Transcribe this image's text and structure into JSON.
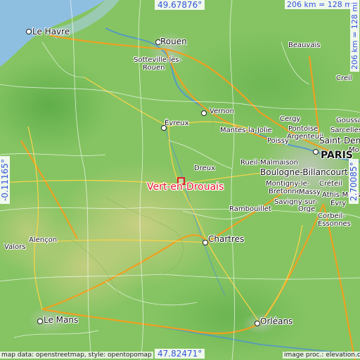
{
  "target": {
    "name": "Vert-en-Drouais",
    "color": "#e8182a"
  },
  "coordinates": {
    "top": "49.67876°",
    "bottom": "47.82471°",
    "left": "-0.11165°",
    "right": "2.70085°"
  },
  "scale": {
    "horizontal": "206 km = 128 mi",
    "vertical": "206 km = 128 mi"
  },
  "credits": {
    "left": "map data: openstreetmap, style: opentopomap",
    "right": "image proc.: elevation.city"
  },
  "places": [
    {
      "key": "le-havre",
      "name": "Le Havre"
    },
    {
      "key": "rouen",
      "name": "Rouen"
    },
    {
      "key": "sotteville",
      "name": "Sotteville-lès-"
    },
    {
      "key": "sotteville-2",
      "name": "Rouen"
    },
    {
      "key": "beauvais",
      "name": "Beauvais"
    },
    {
      "key": "creil",
      "name": "Creil"
    },
    {
      "key": "vernon",
      "name": "Vernon"
    },
    {
      "key": "evreux",
      "name": "Évreux"
    },
    {
      "key": "mantes",
      "name": "Mantes-la-Jolie"
    },
    {
      "key": "cergy",
      "name": "Cergy"
    },
    {
      "key": "pontoise",
      "name": "Pontoise"
    },
    {
      "key": "argenteuil",
      "name": "Argenteuil"
    },
    {
      "key": "poissy",
      "name": "Poissy"
    },
    {
      "key": "saint-denis",
      "name": "Saint-Denis"
    },
    {
      "key": "goussainville",
      "name": "Goussa"
    },
    {
      "key": "sarcelles",
      "name": "Sarcelles"
    },
    {
      "key": "montreuil",
      "name": "Mo"
    },
    {
      "key": "paris",
      "name": "PARIS"
    },
    {
      "key": "rueil",
      "name": "Rueil-Malmaison"
    },
    {
      "key": "boulogne",
      "name": "Boulogne-Billancourt"
    },
    {
      "key": "dreux",
      "name": "Dreux"
    },
    {
      "key": "montigny",
      "name": "Montigny-le-"
    },
    {
      "key": "montigny-2",
      "name": "Bretonneux"
    },
    {
      "key": "massy",
      "name": "Massy"
    },
    {
      "key": "creteil",
      "name": "Créteil"
    },
    {
      "key": "athis",
      "name": "Athis-Mons"
    },
    {
      "key": "savigny",
      "name": "Savigny-sur-"
    },
    {
      "key": "savigny-2",
      "name": "Orge"
    },
    {
      "key": "evry",
      "name": "Évry"
    },
    {
      "key": "corbeil",
      "name": "Corbeil-"
    },
    {
      "key": "corbeil-2",
      "name": "Essonnes"
    },
    {
      "key": "rambouillet",
      "name": "Rambouillet"
    },
    {
      "key": "chartres",
      "name": "Chartres"
    },
    {
      "key": "alencon",
      "name": "Alençon"
    },
    {
      "key": "valors",
      "name": "Valors"
    },
    {
      "key": "le-mans",
      "name": "Le Mans"
    },
    {
      "key": "orleans",
      "name": "Orléans"
    }
  ]
}
